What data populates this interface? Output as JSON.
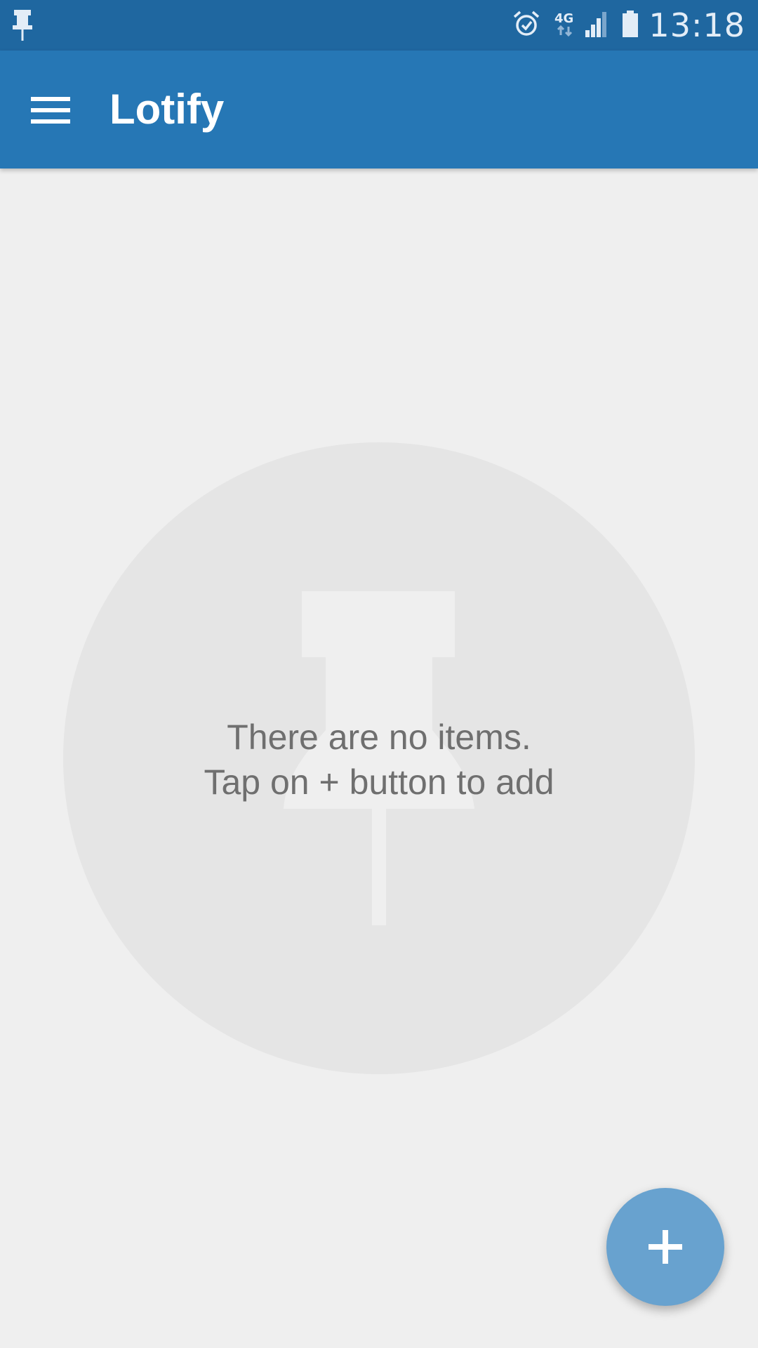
{
  "status_bar": {
    "left_icon": "pushpin-icon",
    "icons": [
      "alarm-icon",
      "4g-icon",
      "signal-icon",
      "battery-icon"
    ],
    "network_label": "4G",
    "time": "13:18"
  },
  "app_bar": {
    "menu_icon": "hamburger-menu-icon",
    "title": "Lotify"
  },
  "empty_state": {
    "icon": "pushpin-icon",
    "line1": "There are no items.",
    "line2": "Tap on + button to add"
  },
  "fab": {
    "icon": "plus-icon"
  },
  "colors": {
    "status_bar": "#1f67a0",
    "app_bar": "#2677b5",
    "background": "#efefef",
    "circle": "#e5e5e5",
    "fab": "#68a2cf",
    "text_muted": "#6f6f6f"
  }
}
